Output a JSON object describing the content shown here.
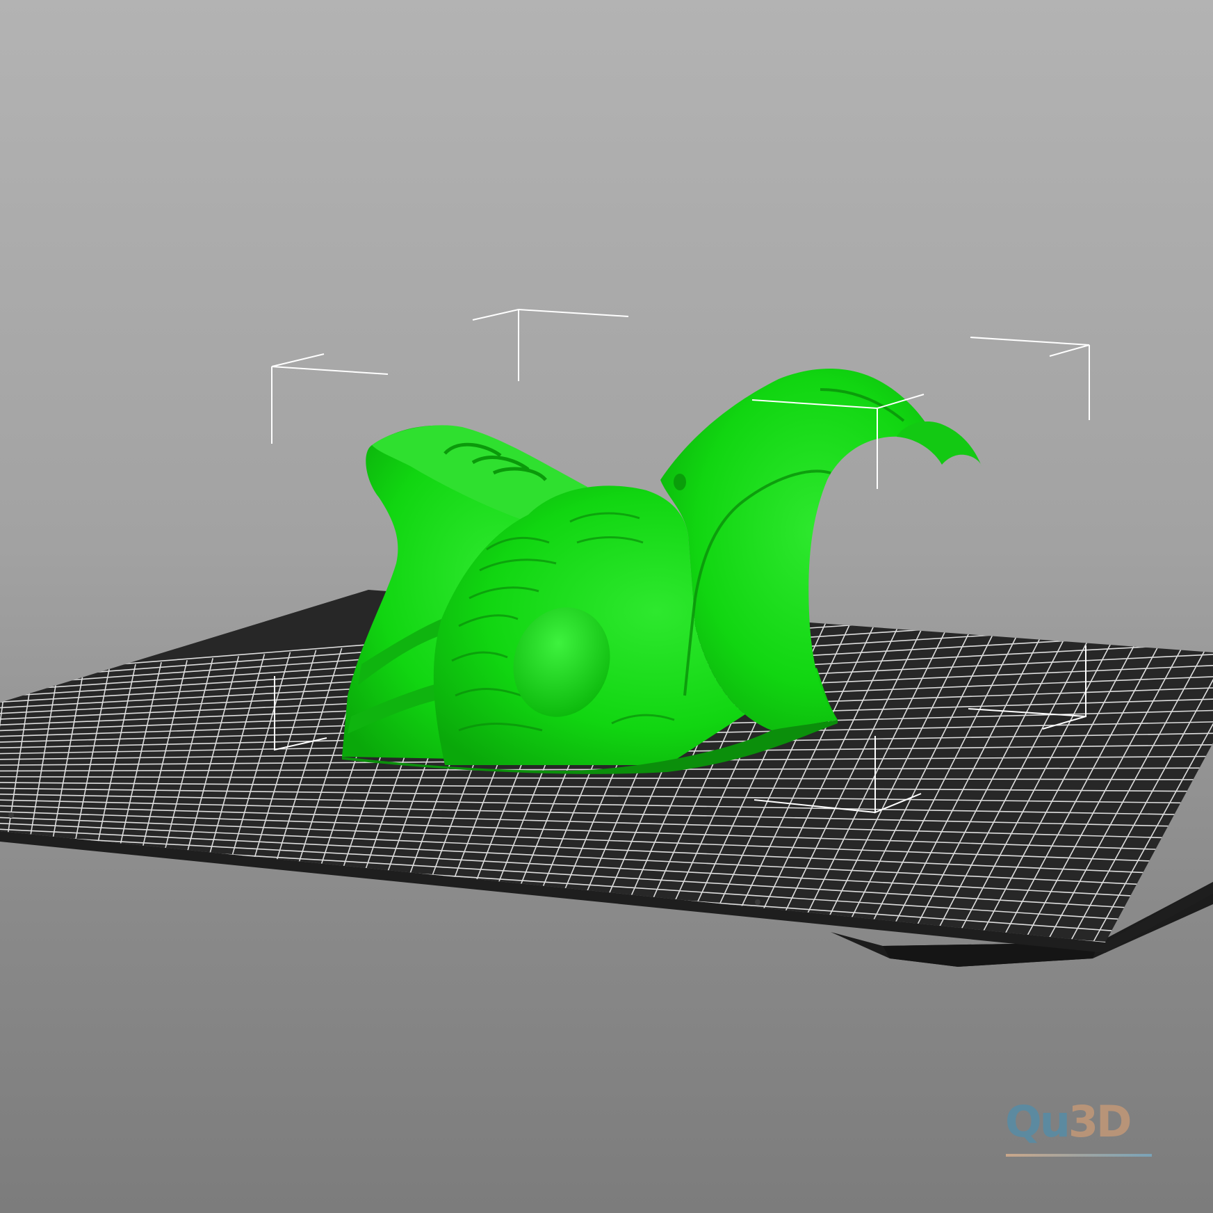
{
  "viewport": {
    "background_top": "#b3b3b3",
    "background_bottom": "#7c7c7c"
  },
  "bed": {
    "plate_color": "#262626",
    "grid_color": "#ffffff",
    "base_color": "#1c1c1c"
  },
  "model": {
    "color": "#11d611",
    "shade_color": "#0a9e0a",
    "highlight_color": "#3ff03f"
  },
  "bounding_box": {
    "color": "#ffffff"
  },
  "watermark": {
    "part1": "Qu",
    "part2": "3D",
    "part1_color": "#5c8aa0",
    "part2_color": "#b89478"
  }
}
